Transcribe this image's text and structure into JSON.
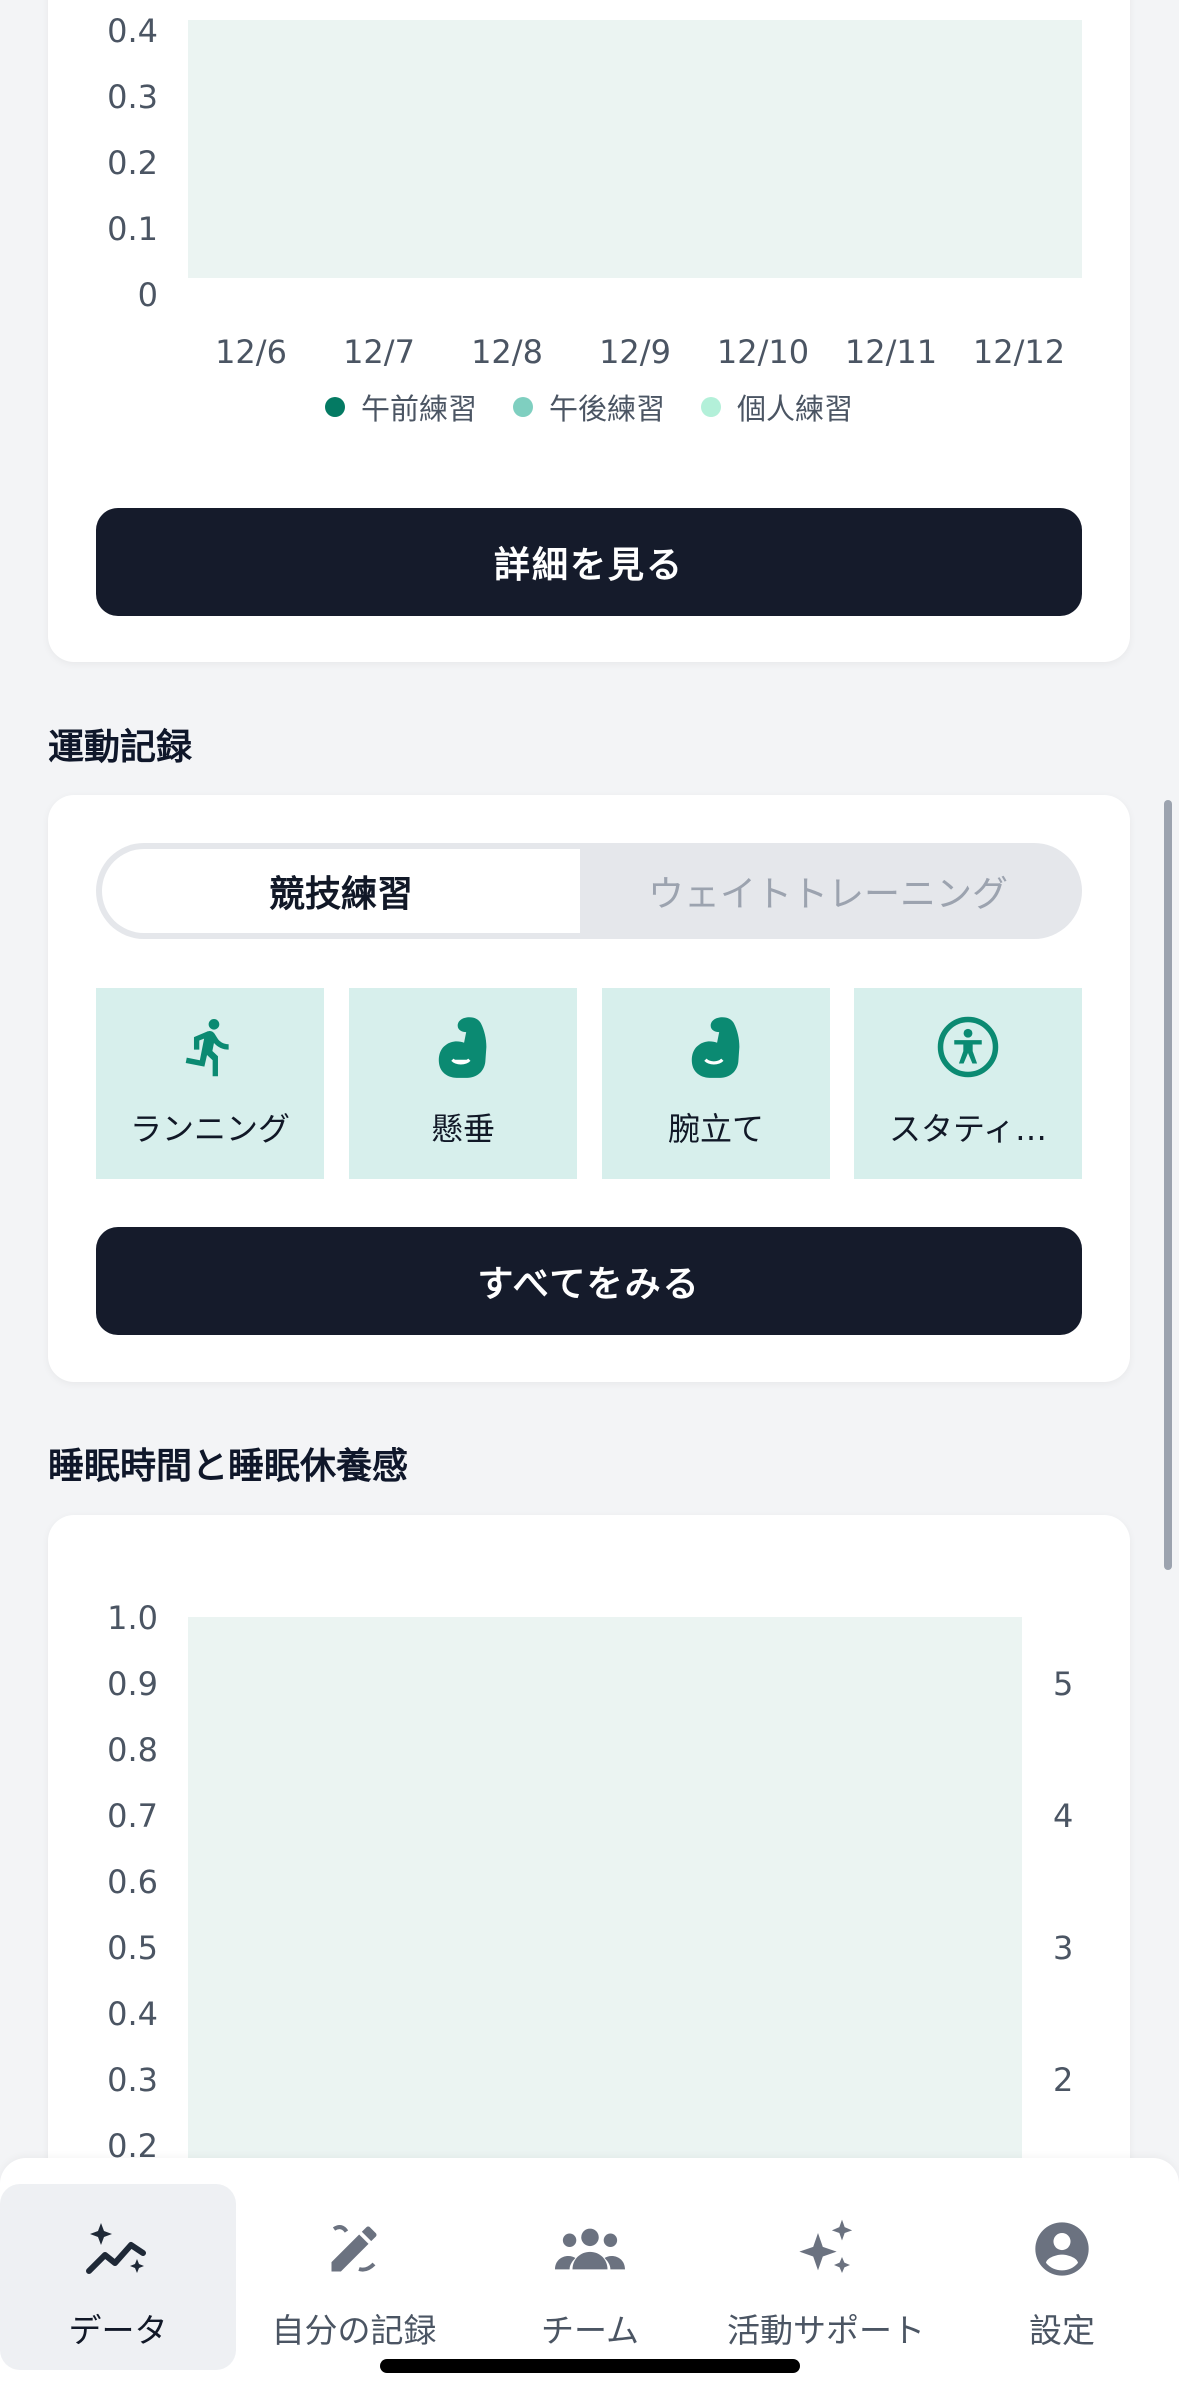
{
  "practice_chart": {
    "chart_data": {
      "type": "bar",
      "categories": [
        "12/6",
        "12/7",
        "12/8",
        "12/9",
        "12/10",
        "12/11",
        "12/12"
      ],
      "series": [
        {
          "name": "午前練習",
          "values": [
            0,
            0,
            0,
            0,
            0,
            0,
            0
          ],
          "color": "#047a63"
        },
        {
          "name": "午後練習",
          "values": [
            0,
            0,
            0,
            0,
            0,
            0,
            0
          ],
          "color": "#7fcfc0"
        },
        {
          "name": "個人練習",
          "values": [
            0,
            0,
            0,
            0,
            0,
            0,
            0
          ],
          "color": "#b3f0d9"
        }
      ],
      "y_ticks": [
        "0.4",
        "0.3",
        "0.2",
        "0.1",
        "0"
      ],
      "ylim": [
        0,
        0.4
      ],
      "legend_position": "bottom"
    },
    "details_button": "詳細を見る"
  },
  "exercise": {
    "title": "運動記録",
    "tabs": [
      {
        "label": "競技練習",
        "active": true
      },
      {
        "label": "ウェイトトレーニング",
        "active": false
      }
    ],
    "items": [
      {
        "label": "ランニング",
        "icon": "running-icon"
      },
      {
        "label": "懸垂",
        "icon": "flexed-arm-icon"
      },
      {
        "label": "腕立て",
        "icon": "flexed-arm-icon"
      },
      {
        "label": "スタティ…",
        "icon": "accessibility-icon"
      }
    ],
    "see_all_button": "すべてをみる"
  },
  "sleep": {
    "title": "睡眠時間と睡眠休養感",
    "chart_data": {
      "type": "bar",
      "y_ticks": [
        "1.0",
        "0.9",
        "0.8",
        "0.7",
        "0.6",
        "0.5",
        "0.4",
        "0.3",
        "0.2"
      ],
      "y_right_ticks": [
        "5",
        "4",
        "3",
        "2"
      ],
      "ylim": [
        0,
        1.0
      ],
      "y2lim": [
        0,
        5
      ]
    }
  },
  "nav": {
    "items": [
      {
        "label": "データ",
        "icon": "chart-sparkle-icon",
        "active": true
      },
      {
        "label": "自分の記録",
        "icon": "edit-pencil-icon",
        "active": false
      },
      {
        "label": "チーム",
        "icon": "group-icon",
        "active": false
      },
      {
        "label": "活動サポート",
        "icon": "sparkles-icon",
        "active": false
      },
      {
        "label": "設定",
        "icon": "account-circle-icon",
        "active": false
      }
    ]
  },
  "colors": {
    "accent": "#0b8a72",
    "dark_button": "#151b2b",
    "tile_bg": "#d7efec",
    "plot_bg": "#ebf4f2"
  }
}
